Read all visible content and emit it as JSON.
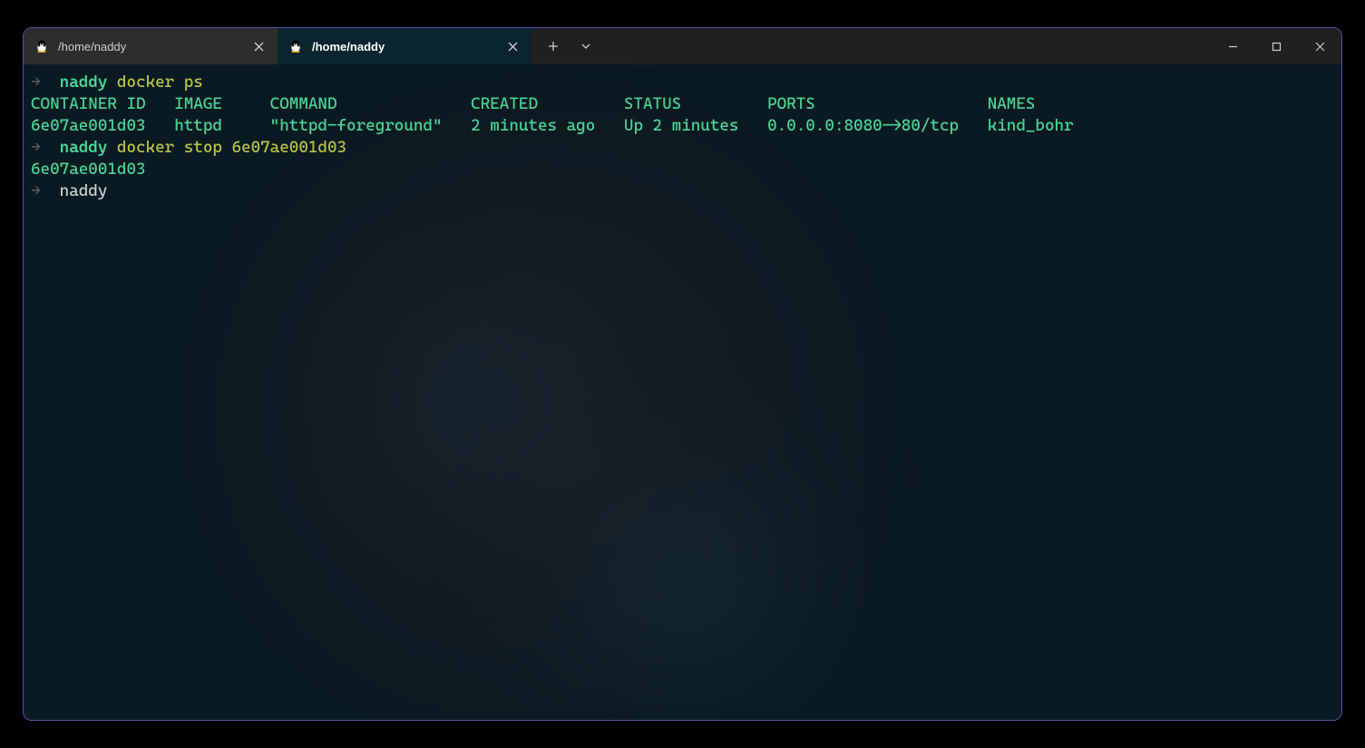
{
  "tabs": [
    {
      "title": "/home/naddy",
      "active": false
    },
    {
      "title": "/home/naddy",
      "active": true
    }
  ],
  "prompt": {
    "arrow": "→",
    "dir": "naddy"
  },
  "cmd1": {
    "part1": "docker",
    "part2": "ps"
  },
  "headers": {
    "container_id": "CONTAINER ID",
    "image": "IMAGE",
    "command": "COMMAND",
    "created": "CREATED",
    "status": "STATUS",
    "ports": "PORTS",
    "names": "NAMES"
  },
  "row": {
    "container_id": "6e07ae001d03",
    "image": "httpd",
    "command": "\"httpd-foreground\"",
    "created": "2 minutes ago",
    "status": "Up 2 minutes",
    "ports": "0.0.0.0:8080->80/tcp",
    "names": "kind_bohr"
  },
  "cmd2": {
    "part1": "docker",
    "part2": "stop",
    "arg": "6e07ae001d03"
  },
  "output2": "6e07ae001d03"
}
